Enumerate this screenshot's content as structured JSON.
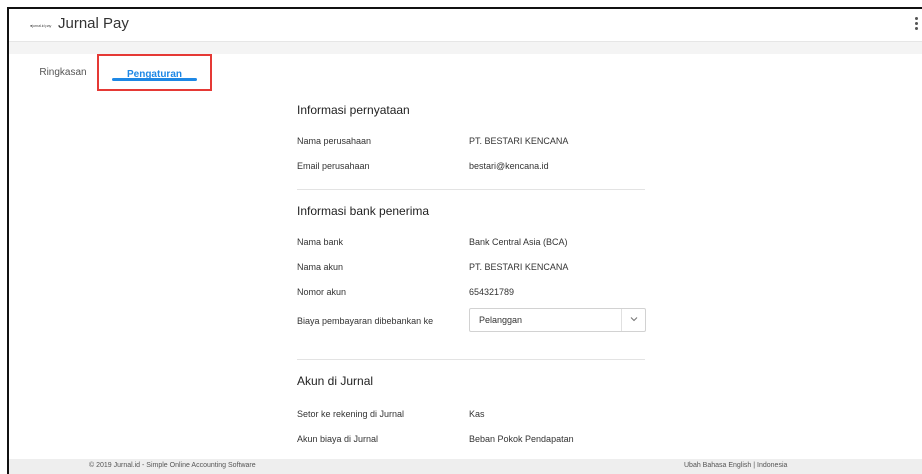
{
  "app": {
    "logo_text": "●jurnal.id pay",
    "title": "Jurnal Pay"
  },
  "tabs": [
    {
      "label": "Ringkasan"
    },
    {
      "label": "Pengaturan"
    }
  ],
  "sections": {
    "statement": {
      "title": "Informasi pernyataan",
      "company_name_label": "Nama perusahaan",
      "company_name_value": "PT. BESTARI KENCANA",
      "company_email_label": "Email perusahaan",
      "company_email_value": "bestari@kencana.id"
    },
    "bank": {
      "title": "Informasi bank penerima",
      "bank_name_label": "Nama bank",
      "bank_name_value": "Bank Central Asia (BCA)",
      "account_name_label": "Nama akun",
      "account_name_value": "PT. BESTARI KENCANA",
      "account_number_label": "Nomor akun",
      "account_number_value": "654321789",
      "fee_label": "Biaya pembayaran dibebankan ke",
      "fee_value": "Pelanggan"
    },
    "jurnal": {
      "title": "Akun di Jurnal",
      "deposit_label": "Setor ke rekening di Jurnal",
      "deposit_value": "Kas",
      "expense_label": "Akun biaya di Jurnal",
      "expense_value": "Beban Pokok Pendapatan"
    }
  },
  "footer": {
    "copyright": "© 2019 Jurnal.id - Simple Online Accounting Software",
    "language": "Ubah Bahasa English | Indonesia"
  },
  "colors": {
    "accent": "#1e88e5",
    "highlight_border": "#e53935"
  }
}
